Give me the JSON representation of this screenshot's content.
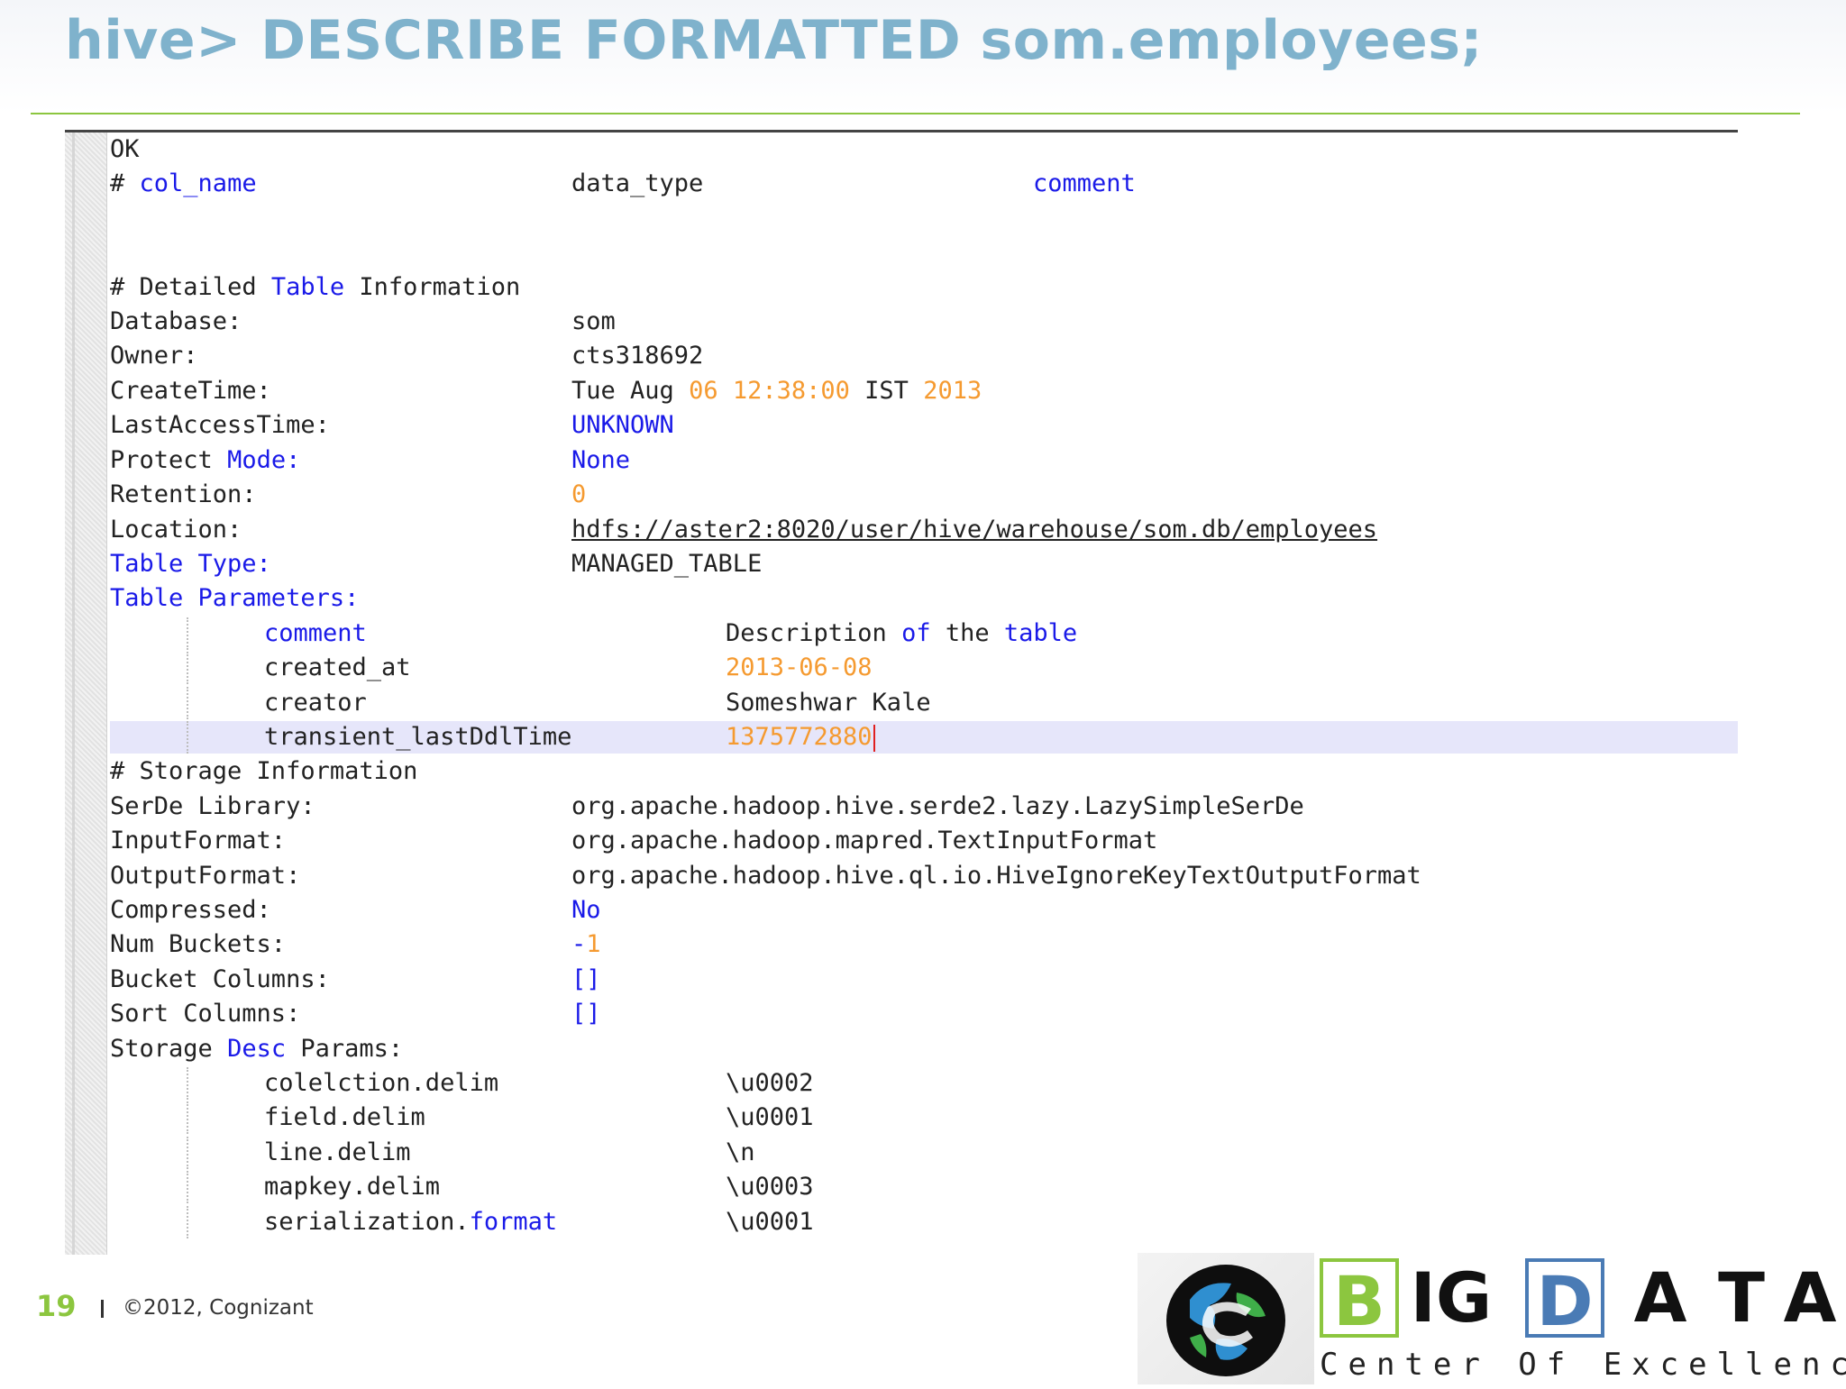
{
  "slide": {
    "title": "hive> DESCRIBE FORMATTED som.employees;",
    "page_number": "19",
    "copyright": "©2012, Cognizant"
  },
  "colors": {
    "title": "#7fb2cc",
    "accent_green": "#8cc63f",
    "keyword_blue": "#1a1ae8",
    "number_orange": "#f59a30",
    "highlight": "#e6e6fa"
  },
  "console": {
    "ok": "OK",
    "header": {
      "hash": "#",
      "col_name": "col_name",
      "data_type": "data_type",
      "comment": "comment"
    },
    "detailed": {
      "hash": "#",
      "w1": "Detailed",
      "w2": "Table",
      "w3": "Information"
    },
    "database": {
      "label": "Database:",
      "value": "som"
    },
    "owner": {
      "label": "Owner:",
      "value": "cts318692"
    },
    "create_time": {
      "label": "CreateTime:",
      "p1": "Tue Aug",
      "p2": "06 12:38:00",
      "p3": "IST",
      "p4": "2013"
    },
    "last_access": {
      "label": "LastAccessTime:",
      "value": "UNKNOWN"
    },
    "protect": {
      "w1": "Protect",
      "w2": "Mode:",
      "value": "None"
    },
    "retention": {
      "label": "Retention:",
      "value": "0"
    },
    "location": {
      "label": "Location:",
      "value": "hdfs://aster2:8020/user/hive/warehouse/som.db/employees"
    },
    "table_type": {
      "label": "Table Type:",
      "value": "MANAGED_TABLE"
    },
    "table_params": {
      "label": "Table Parameters:",
      "comment": {
        "key": "comment",
        "v1": "Description",
        "v2": "of",
        "v3": "the",
        "v4": "table"
      },
      "created_at": {
        "key": "created_at",
        "value": "2013-06-08"
      },
      "creator": {
        "key": "creator",
        "value": "Someshwar Kale"
      },
      "transient": {
        "key": "transient_lastDdlTime",
        "value": "1375772880"
      }
    },
    "storage_header": "# Storage Information",
    "serde": {
      "label": "SerDe Library:",
      "value": "org.apache.hadoop.hive.serde2.lazy.LazySimpleSerDe"
    },
    "input_format": {
      "label": "InputFormat:",
      "value": "org.apache.hadoop.mapred.TextInputFormat"
    },
    "output_format": {
      "label": "OutputFormat:",
      "value": "org.apache.hadoop.hive.ql.io.HiveIgnoreKeyTextOutputFormat"
    },
    "compressed": {
      "label": "Compressed:",
      "value": "No"
    },
    "num_buckets": {
      "label": "Num Buckets:",
      "p1": "-",
      "p2": "1"
    },
    "bucket_cols": {
      "label": "Bucket Columns:",
      "value": "[]"
    },
    "sort_cols": {
      "label": "Sort Columns:",
      "value": "[]"
    },
    "storage_params": {
      "w1": "Storage",
      "w2": "Desc",
      "w3": "Params:",
      "colelction": {
        "key": "colelction.delim",
        "value": "\\u0002"
      },
      "field": {
        "key": "field.delim",
        "value": "\\u0001"
      },
      "line": {
        "key": "line.delim",
        "value": "\\n"
      },
      "mapkey": {
        "key": "mapkey.delim",
        "value": "\\u0003"
      },
      "serialization": {
        "k1": "serialization.",
        "k2": "format",
        "value": "\\u0001"
      }
    }
  },
  "logo": {
    "globe_icon": "cognizant-globe-icon",
    "b": "B",
    "ig": "IG",
    "d": "D",
    "a1": "A",
    "t": "T",
    "a2": "A",
    "tagline": "Center Of Excellence"
  }
}
